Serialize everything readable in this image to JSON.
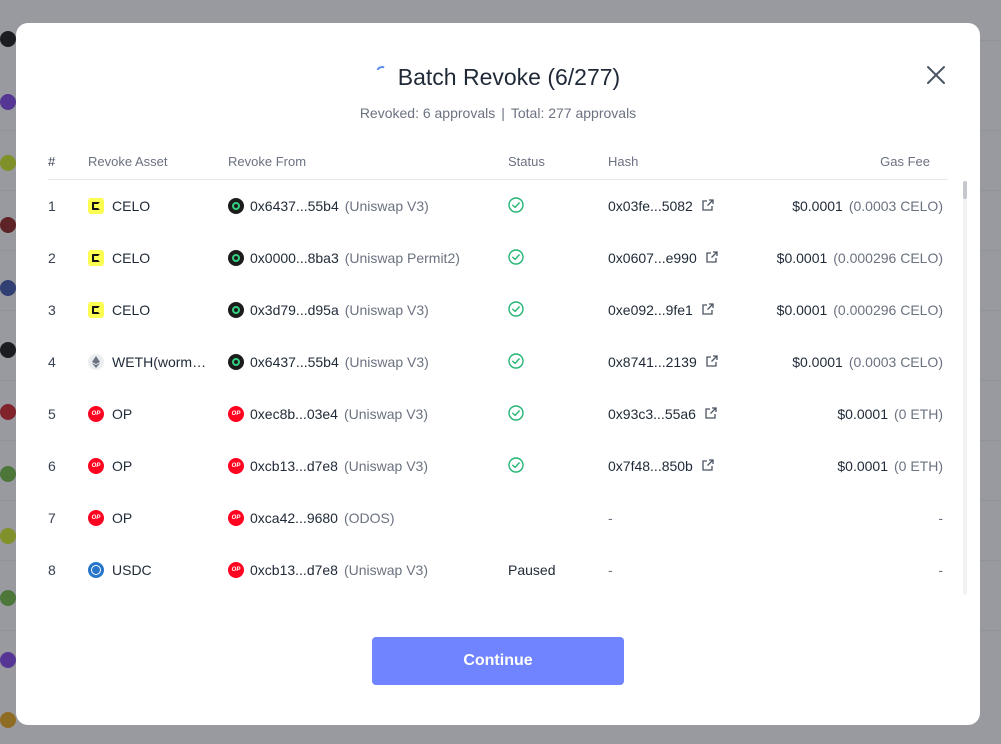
{
  "modal": {
    "title": "Batch Revoke (6/277)",
    "revoked_text": "Revoked: 6 approvals",
    "separator": "|",
    "total_text": "Total: 277 approvals",
    "continue_label": "Continue"
  },
  "table": {
    "headers": {
      "index": "#",
      "asset": "Revoke Asset",
      "from": "Revoke From",
      "status": "Status",
      "hash": "Hash",
      "gas": "Gas Fee"
    },
    "rows": [
      {
        "index": "1",
        "asset": "CELO",
        "asset_icon": "celo",
        "from_addr": "0x6437...55b4",
        "from_name": "(Uniswap V3)",
        "from_icon": "uniswap-celo",
        "status": "done",
        "status_text": "",
        "hash": "0x03fe...5082",
        "gas_usd": "$0.0001",
        "gas_native": "(0.0003 CELO)"
      },
      {
        "index": "2",
        "asset": "CELO",
        "asset_icon": "celo",
        "from_addr": "0x0000...8ba3",
        "from_name": "(Uniswap Permit2)",
        "from_icon": "uniswap-celo",
        "status": "done",
        "status_text": "",
        "hash": "0x0607...e990",
        "gas_usd": "$0.0001",
        "gas_native": "(0.000296 CELO)"
      },
      {
        "index": "3",
        "asset": "CELO",
        "asset_icon": "celo",
        "from_addr": "0x3d79...d95a",
        "from_name": "(Uniswap V3)",
        "from_icon": "uniswap-celo",
        "status": "done",
        "status_text": "",
        "hash": "0xe092...9fe1",
        "gas_usd": "$0.0001",
        "gas_native": "(0.000296 CELO)"
      },
      {
        "index": "4",
        "asset": "WETH(wormh...",
        "asset_icon": "weth",
        "from_addr": "0x6437...55b4",
        "from_name": "(Uniswap V3)",
        "from_icon": "uniswap-celo",
        "status": "done",
        "status_text": "",
        "hash": "0x8741...2139",
        "gas_usd": "$0.0001",
        "gas_native": "(0.0003 CELO)"
      },
      {
        "index": "5",
        "asset": "OP",
        "asset_icon": "op",
        "from_addr": "0xec8b...03e4",
        "from_name": "(Uniswap V3)",
        "from_icon": "op",
        "status": "done",
        "status_text": "",
        "hash": "0x93c3...55a6",
        "gas_usd": "$0.0001",
        "gas_native": "(0 ETH)"
      },
      {
        "index": "6",
        "asset": "OP",
        "asset_icon": "op",
        "from_addr": "0xcb13...d7e8",
        "from_name": "(Uniswap V3)",
        "from_icon": "op",
        "status": "done",
        "status_text": "",
        "hash": "0x7f48...850b",
        "gas_usd": "$0.0001",
        "gas_native": "(0 ETH)"
      },
      {
        "index": "7",
        "asset": "OP",
        "asset_icon": "op",
        "from_addr": "0xca42...9680",
        "from_name": "(ODOS)",
        "from_icon": "op",
        "status": "none",
        "status_text": "",
        "hash": "-",
        "gas_usd": "-",
        "gas_native": ""
      },
      {
        "index": "8",
        "asset": "USDC",
        "asset_icon": "usdc",
        "from_addr": "0xcb13...d7e8",
        "from_name": "(Uniswap V3)",
        "from_icon": "op",
        "status": "paused",
        "status_text": "Paused",
        "hash": "-",
        "gas_usd": "-",
        "gas_native": ""
      }
    ]
  },
  "colors": {
    "accent": "#7084ff",
    "success": "#22b573",
    "celo": "#fcff52",
    "op": "#ff0420",
    "usdc": "#2775ca"
  }
}
